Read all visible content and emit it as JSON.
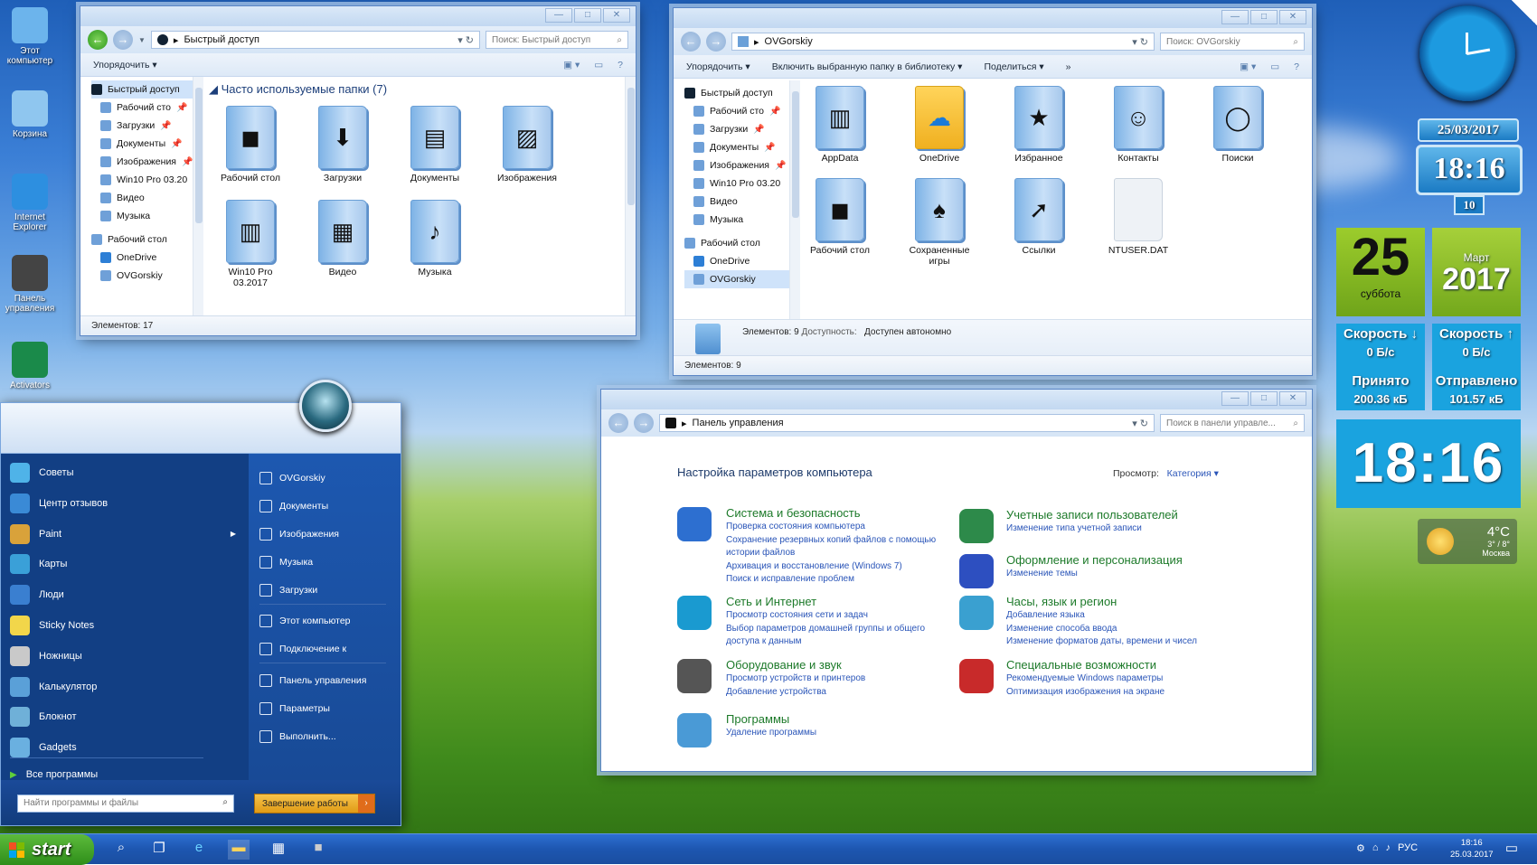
{
  "desktop": {
    "icons": [
      {
        "label": "Этот компьютер"
      },
      {
        "label": "Корзина"
      },
      {
        "label": "Internet Explorer"
      },
      {
        "label": "Панель управления"
      },
      {
        "label": "Activators"
      }
    ]
  },
  "explorer1": {
    "address": "Быстрый доступ",
    "search": "Поиск: Быстрый доступ",
    "organize": "Упорядочить",
    "nav": [
      {
        "label": "Быстрый доступ",
        "pinned": false
      },
      {
        "label": "Рабочий сто",
        "pinned": true
      },
      {
        "label": "Загрузки",
        "pinned": true
      },
      {
        "label": "Документы",
        "pinned": true
      },
      {
        "label": "Изображения",
        "pinned": true
      },
      {
        "label": "Win10 Pro 03.20",
        "pinned": false
      },
      {
        "label": "Видео",
        "pinned": false
      },
      {
        "label": "Музыка",
        "pinned": false
      },
      {
        "label": "Рабочий стол",
        "pinned": false
      },
      {
        "label": "OneDrive",
        "pinned": false
      },
      {
        "label": "OVGorskiy",
        "pinned": false
      }
    ],
    "group_header": "Часто используемые папки (7)",
    "items": [
      {
        "label": "Рабочий стол",
        "icon": "desktop-icon"
      },
      {
        "label": "Загрузки",
        "icon": "download-icon"
      },
      {
        "label": "Документы",
        "icon": "document-icon"
      },
      {
        "label": "Изображения",
        "icon": "image-icon"
      },
      {
        "label": "Win10 Pro 03.2017",
        "icon": "folder-icon"
      },
      {
        "label": "Видео",
        "icon": "video-icon"
      },
      {
        "label": "Музыка",
        "icon": "music-icon"
      }
    ],
    "status": "Элементов: 17"
  },
  "explorer2": {
    "address": "OVGorskiy",
    "search": "Поиск: OVGorskiy",
    "organize": "Упорядочить",
    "include": "Включить выбранную папку в библиотеку",
    "share": "Поделиться",
    "more": "»",
    "nav": [
      {
        "label": "Быстрый доступ",
        "pinned": false
      },
      {
        "label": "Рабочий сто",
        "pinned": true
      },
      {
        "label": "Загрузки",
        "pinned": true
      },
      {
        "label": "Документы",
        "pinned": true
      },
      {
        "label": "Изображения",
        "pinned": true
      },
      {
        "label": "Win10 Pro 03.20",
        "pinned": false
      },
      {
        "label": "Видео",
        "pinned": false
      },
      {
        "label": "Музыка",
        "pinned": false
      },
      {
        "label": "Рабочий стол",
        "pinned": false
      },
      {
        "label": "OneDrive",
        "pinned": false
      },
      {
        "label": "OVGorskiy",
        "pinned": false
      }
    ],
    "items": [
      {
        "label": "AppData",
        "icon": "folder-icon"
      },
      {
        "label": "OneDrive",
        "icon": "cloud-icon"
      },
      {
        "label": "Избранное",
        "icon": "star-icon"
      },
      {
        "label": "Контакты",
        "icon": "contacts-icon"
      },
      {
        "label": "Поиски",
        "icon": "search-icon"
      },
      {
        "label": "Рабочий стол",
        "icon": "desktop-icon"
      },
      {
        "label": "Сохраненные игры",
        "icon": "spade-icon"
      },
      {
        "label": "Ссылки",
        "icon": "link-icon"
      },
      {
        "label": "NTUSER.DAT",
        "icon": "file-icon"
      }
    ],
    "details": {
      "count": "Элементов: 9",
      "avail_label": "Доступность:",
      "avail_value": "Доступен автономно"
    },
    "status": "Элементов: 9"
  },
  "control_panel": {
    "address": "Панель управления",
    "search": "Поиск в панели управле...",
    "heading": "Настройка параметров компьютера",
    "view_label": "Просмотр:",
    "view_value": "Категория",
    "left": [
      {
        "title": "Система и безопасность",
        "links": [
          "Проверка состояния компьютера",
          "Сохранение резервных копий файлов с помощью истории файлов",
          "Архивация и восстановление (Windows 7)",
          "Поиск и исправление проблем"
        ]
      },
      {
        "title": "Сеть и Интернет",
        "links": [
          "Просмотр состояния сети и задач",
          "Выбор параметров домашней группы и общего доступа к данным"
        ]
      },
      {
        "title": "Оборудование и звук",
        "links": [
          "Просмотр устройств и принтеров",
          "Добавление устройства"
        ]
      },
      {
        "title": "Программы",
        "links": [
          "Удаление программы"
        ]
      }
    ],
    "right": [
      {
        "title": "Учетные записи пользователей",
        "links": [
          "Изменение типа учетной записи"
        ]
      },
      {
        "title": "Оформление и персонализация",
        "links": [
          "Изменение темы"
        ]
      },
      {
        "title": "Часы, язык и регион",
        "links": [
          "Добавление языка",
          "Изменение способа ввода",
          "Изменение форматов даты, времени и чисел"
        ]
      },
      {
        "title": "Специальные возможности",
        "links": [
          "Рекомендуемые Windows параметры",
          "Оптимизация изображения на экране"
        ]
      }
    ]
  },
  "start_menu": {
    "left": [
      {
        "label": "Советы"
      },
      {
        "label": "Центр отзывов"
      },
      {
        "label": "Paint"
      },
      {
        "label": "Карты"
      },
      {
        "label": "Люди"
      },
      {
        "label": "Sticky Notes"
      },
      {
        "label": "Ножницы"
      },
      {
        "label": "Калькулятор"
      },
      {
        "label": "Блокнот"
      },
      {
        "label": "Gadgets"
      }
    ],
    "all_programs": "Все программы",
    "right": [
      {
        "label": "OVGorskiy"
      },
      {
        "label": "Документы"
      },
      {
        "label": "Изображения"
      },
      {
        "label": "Музыка"
      },
      {
        "label": "Загрузки"
      },
      {
        "label": "Этот компьютер"
      },
      {
        "label": "Подключение к"
      },
      {
        "label": "Панель управления"
      },
      {
        "label": "Параметры"
      },
      {
        "label": "Выполнить..."
      }
    ],
    "search_placeholder": "Найти программы и файлы",
    "shutdown": "Завершение работы"
  },
  "taskbar": {
    "start": "start",
    "lang": "РУС",
    "time": "18:16",
    "date": "25.03.2017"
  },
  "gadgets": {
    "date_banner": "25/03/2017",
    "clock_time": "18:16",
    "clock_day": "10",
    "cal_day": "25",
    "cal_weekday": "суббота",
    "cal_month": "Март",
    "cal_year": "2017",
    "net_down_label": "Скорость ↓",
    "net_down_value": "0 Б/с",
    "net_up_label": "Скорость ↑",
    "net_up_value": "0 Б/с",
    "recv_label": "Принято",
    "recv_value": "200.36 кБ",
    "sent_label": "Отправлено",
    "sent_value": "101.57 кБ",
    "big_time": "18:16",
    "weather_temp": "4°C",
    "weather_range": "3° / 8°",
    "weather_city": "Москва",
    "accent": "#1aa3df",
    "calendar_green": "#7cb51e"
  }
}
